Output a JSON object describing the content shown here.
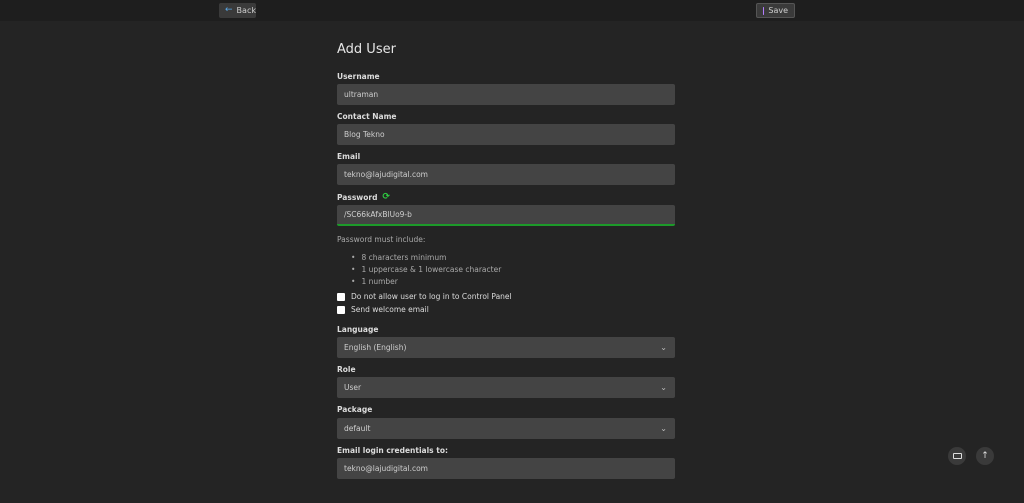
{
  "toolbar": {
    "back_label": "Back",
    "save_label": "Save"
  },
  "page_title": "Add User",
  "fields": {
    "username": {
      "label": "Username",
      "value": "ultraman"
    },
    "contact_name": {
      "label": "Contact Name",
      "value": "Blog Tekno"
    },
    "email": {
      "label": "Email",
      "value": "tekno@lajudigital.com"
    },
    "password": {
      "label": "Password",
      "value": "/SC66kAfxBlUo9-b"
    }
  },
  "password_rules": {
    "heading": "Password must include:",
    "items": [
      "8 characters minimum",
      "1 uppercase & 1 lowercase character",
      "1 number"
    ]
  },
  "checkboxes": {
    "deny_login": "Do not allow user to log in to Control Panel",
    "welcome_email": "Send welcome email"
  },
  "selects": {
    "language": {
      "label": "Language",
      "value": "English (English)"
    },
    "role": {
      "label": "Role",
      "value": "User"
    },
    "package": {
      "label": "Package",
      "value": "default"
    }
  },
  "email_credentials": {
    "label": "Email login credentials to:",
    "value": "tekno@lajudigital.com"
  },
  "icons": {
    "back": "arrow-left-icon",
    "save": "floppy-disk-icon",
    "refresh": "refresh-icon",
    "chevron": "chevron-down-icon",
    "keyboard": "keyboard-icon",
    "scroll_top": "arrow-up-icon"
  },
  "colors": {
    "background": "#242424",
    "field": "#444444",
    "accent_green": "#2ecc40",
    "accent_blue": "#5aa8e6",
    "save_icon": "#b37cff"
  }
}
